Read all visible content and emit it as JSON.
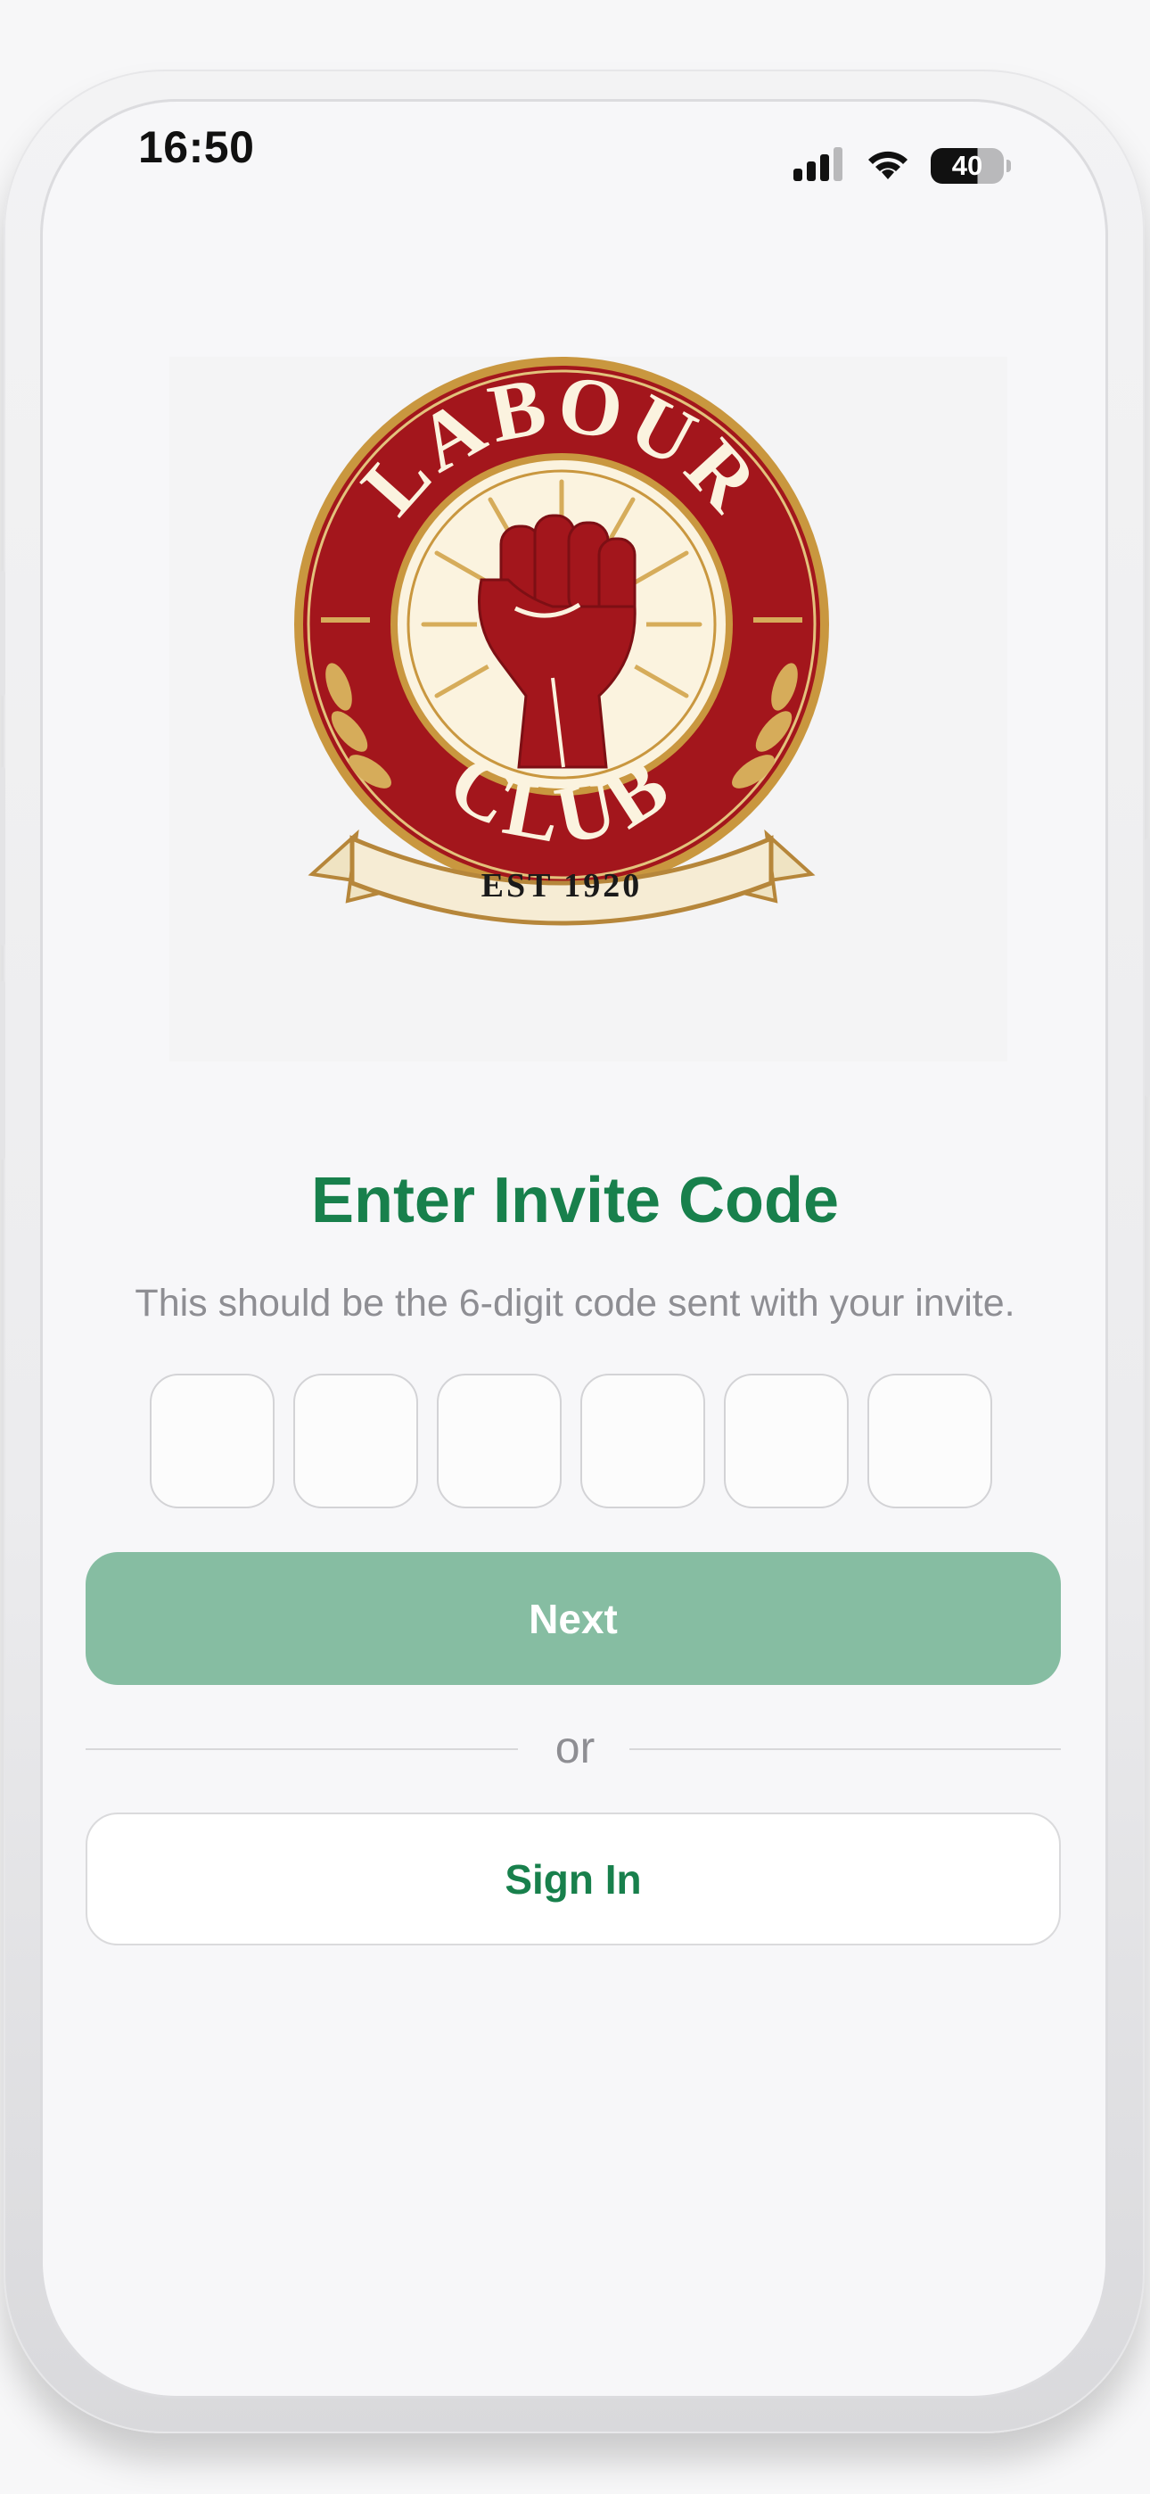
{
  "status_bar": {
    "time": "16:50",
    "battery_level": "40",
    "icons": [
      "signal-icon",
      "wifi-icon",
      "battery-icon"
    ]
  },
  "logo": {
    "top_text": "LABOUR",
    "bottom_text": "CLUB",
    "ribbon_text": "EST 1920"
  },
  "invite": {
    "title": "Enter Invite Code",
    "subtitle": "This should be the 6-digit code sent with your invite.",
    "code_digits": [
      "",
      "",
      "",
      "",
      "",
      ""
    ]
  },
  "actions": {
    "next_label": "Next",
    "or_label": "or",
    "signin_label": "Sign In"
  },
  "colors": {
    "brand_green": "#18804c",
    "next_disabled": "#86bda2",
    "logo_red": "#a3161c",
    "logo_gold": "#c9973f",
    "logo_cream": "#f6ecd4"
  }
}
